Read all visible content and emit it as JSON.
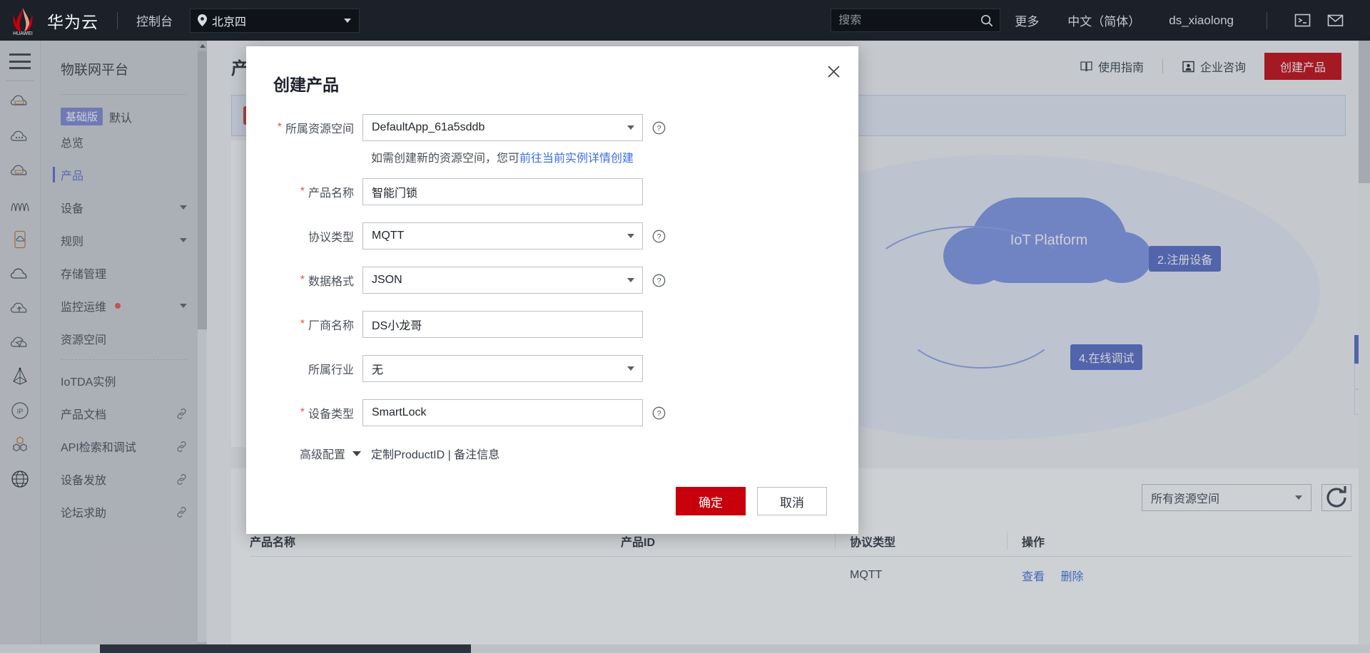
{
  "header": {
    "brand": "华为云",
    "console_label": "控制台",
    "region": "北京四",
    "search_placeholder": "搜索",
    "more_label": "更多",
    "language_label": "中文（简体）",
    "username": "ds_xiaolong",
    "cloudshell_icon": "terminal-icon",
    "message_icon": "mail-icon"
  },
  "sidenav": {
    "title": "物联网平台",
    "edition_badge": "基础版",
    "edition_name": "默认",
    "items": [
      {
        "label": "总览",
        "active": false,
        "caret": false,
        "dot": false,
        "external": false
      },
      {
        "label": "产品",
        "active": true,
        "caret": false,
        "dot": false,
        "external": false
      },
      {
        "label": "设备",
        "active": false,
        "caret": true,
        "dot": false,
        "external": false
      },
      {
        "label": "规则",
        "active": false,
        "caret": true,
        "dot": false,
        "external": false
      },
      {
        "label": "存储管理",
        "active": false,
        "caret": false,
        "dot": false,
        "external": false
      },
      {
        "label": "监控运维",
        "active": false,
        "caret": true,
        "dot": true,
        "external": false
      },
      {
        "label": "资源空间",
        "active": false,
        "caret": false,
        "dot": false,
        "external": false
      },
      {
        "label": "IoTDA实例",
        "active": false,
        "caret": false,
        "dot": false,
        "external": false
      },
      {
        "label": "产品文档",
        "active": false,
        "caret": false,
        "dot": false,
        "external": true
      },
      {
        "label": "API检索和调试",
        "active": false,
        "caret": false,
        "dot": false,
        "external": true
      },
      {
        "label": "设备发放",
        "active": false,
        "caret": false,
        "dot": false,
        "external": true
      },
      {
        "label": "论坛求助",
        "active": false,
        "caret": false,
        "dot": false,
        "external": true
      }
    ],
    "rail_icons": [
      "cloud-server-icon",
      "cloud-dots-icon",
      "cloud-storage-icon",
      "wave-chart-icon",
      "mobile-cloud-icon",
      "cloud-icon",
      "cloud-upload-icon",
      "cloud-send-icon",
      "pyramid-icon",
      "ip-icon",
      "hexagon-cluster-icon",
      "globe-icon"
    ]
  },
  "main": {
    "page_title": "产品",
    "guide_label": "使用指南",
    "consult_label": "企业咨询",
    "create_product_label": "创建产品",
    "resource_space_filter": "所有资源空间",
    "refresh_icon": "refresh-icon",
    "table_headers": [
      "产品名称",
      "产品ID",
      "协议类型",
      "操作"
    ],
    "table_rows": [
      {
        "protocol": "MQTT",
        "action_view": "查看",
        "action_delete": "删除"
      }
    ],
    "graphic": {
      "platform_label": "IoT Platform",
      "step_register": "2.注册设备",
      "step_debug": "4.在线调试"
    }
  },
  "modal": {
    "title": "创建产品",
    "close_icon": "close-icon",
    "fields": [
      {
        "label": "所属资源空间",
        "required": true,
        "type": "select",
        "value": "DefaultApp_61a5sddb",
        "help": true
      },
      {
        "label": "产品名称",
        "required": true,
        "type": "input",
        "value": "智能门锁",
        "help": false
      },
      {
        "label": "协议类型",
        "required": false,
        "type": "select",
        "value": "MQTT",
        "help": true
      },
      {
        "label": "数据格式",
        "required": true,
        "type": "select",
        "value": "JSON",
        "help": true
      },
      {
        "label": "厂商名称",
        "required": true,
        "type": "input",
        "value": "DS小龙哥",
        "help": false
      },
      {
        "label": "所属行业",
        "required": false,
        "type": "select",
        "value": "无",
        "help": false
      },
      {
        "label": "设备类型",
        "required": true,
        "type": "input",
        "value": "SmartLock",
        "help": true
      }
    ],
    "hint_text": "如需创建新的资源空间，您可",
    "hint_link": "前往当前实例详情创建",
    "advanced_label": "高级配置",
    "advanced_summary": "定制ProductID | 备注信息",
    "confirm_label": "确定",
    "cancel_label": "取消"
  },
  "colors": {
    "brand_red": "#c7000b",
    "accent_blue": "#5468c6",
    "link_blue": "#3b6ee0",
    "required_red": "#e8534f",
    "header_bg": "#1c2029"
  }
}
